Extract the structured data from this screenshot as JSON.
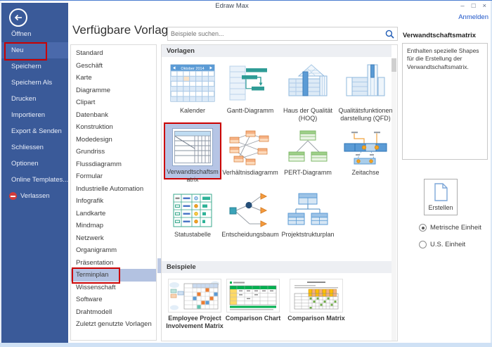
{
  "titlebar": {
    "title": "Edraw Max",
    "minimize": "–",
    "maximize": "□",
    "close": "×",
    "signin": "Anmelden"
  },
  "sidebar": {
    "items": [
      "Öffnen",
      "Neu",
      "Speichern",
      "Speichern Als",
      "Drucken",
      "Importieren",
      "Export & Senden",
      "Schliessen",
      "Optionen",
      "Online Templates...",
      "Verlassen"
    ],
    "active_item": "Neu"
  },
  "main": {
    "heading": "Verfügbare Vorlagen",
    "search_placeholder": "Beispiele suchen...",
    "templates_section": "Vorlagen",
    "examples_section": "Beispiele"
  },
  "categories": {
    "items": [
      "Standard",
      "Geschäft",
      "Karte",
      "Diagramme",
      "Clipart",
      "Datenbank",
      "Konstruktion",
      "Modedesign",
      "Grundriss",
      "Flussdiagramm",
      "Formular",
      "Industrielle Automation",
      "Infografik",
      "Landkarte",
      "Mindmap",
      "Netzwerk",
      "Organigramm",
      "Präsentation",
      "Terminplan",
      "Wissenschaft",
      "Software",
      "Drahtmodell",
      "Zuletzt genutzte Vorlagen"
    ],
    "selected": "Terminplan"
  },
  "templates": {
    "items": [
      "Kalender",
      "Gantt-Diagramm",
      "Haus der Qualität (HOQ)",
      "Qualitätsfunktionendarstellung (QFD)",
      "Verwandtschaftsmatrix",
      "Verhältnisdiagramm",
      "PERT-Diagramm",
      "Zeitachse",
      "Statustabelle",
      "Entscheidungsbaum",
      "Projektstrukturplan"
    ],
    "selected": "Verwandtschaftsmatrix",
    "calendar_header": "Oktober 2014"
  },
  "examples": {
    "items": [
      "Employee Project Involvement Matrix",
      "Comparison Chart",
      "Comparison Matrix"
    ]
  },
  "details": {
    "title": "Verwandtschaftsmatrix",
    "description": "Enthalten spezielle Shapes für die Erstellung der Verwandtschaftsmatrix.",
    "create_label": "Erstellen",
    "units": [
      {
        "label": "Metrische Einheit",
        "selected": true
      },
      {
        "label": "U.S. Einheit",
        "selected": false
      }
    ]
  },
  "colors": {
    "sidebar_blue": "#3a5a99",
    "sidebar_highlight": "#4a69ab",
    "annotation_red": "#cb0000",
    "selection_blue": "#b6c5e5",
    "link_blue": "#1e55c8",
    "accent_blue": "#5b9bd5"
  }
}
